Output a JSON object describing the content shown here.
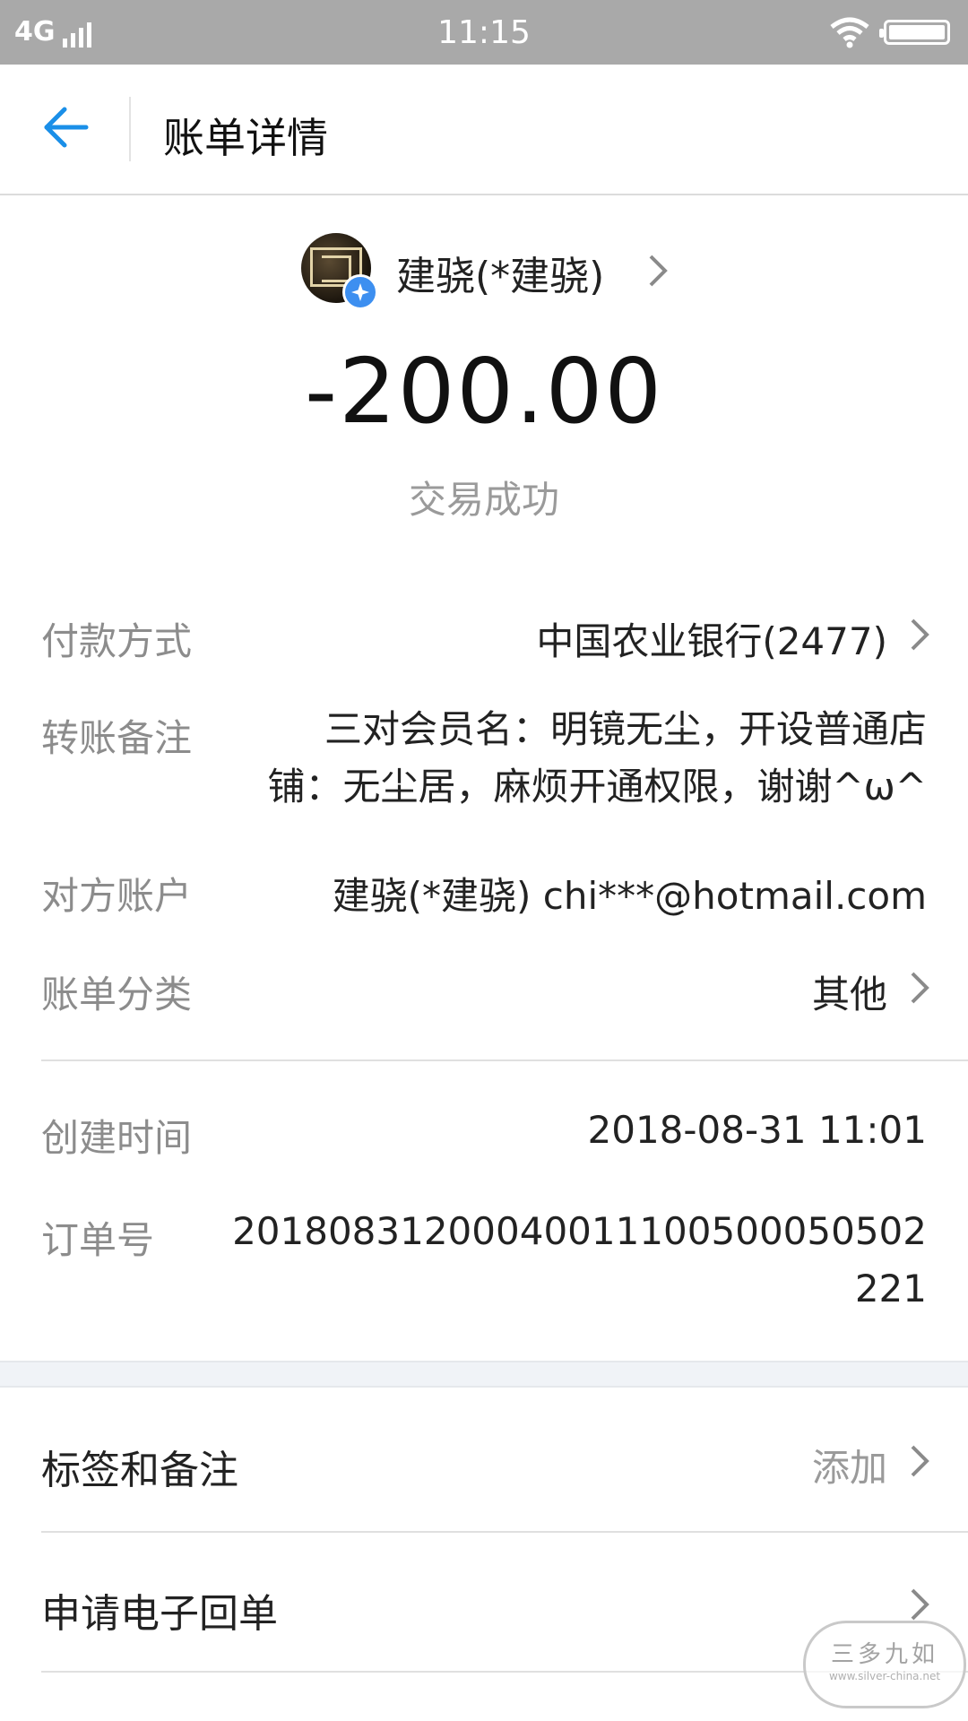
{
  "status_bar": {
    "network": "4G",
    "time": "11:15"
  },
  "nav": {
    "title": "账单详情"
  },
  "header": {
    "merchant_name": "建骁(*建骁)",
    "amount": "-200.00",
    "status": "交易成功"
  },
  "details": {
    "payment_method": {
      "label": "付款方式",
      "value": "中国农业银行(2477)"
    },
    "transfer_note": {
      "label": "转账备注",
      "line1": "三对会员名：明镜无尘，开设普通店",
      "line2": "铺：无尘居，麻烦开通权限，谢谢^ω^"
    },
    "counterparty": {
      "label": "对方账户",
      "value": "建骁(*建骁) chi***@hotmail.com"
    },
    "category": {
      "label": "账单分类",
      "value": "其他"
    },
    "created_time": {
      "label": "创建时间",
      "value": "2018-08-31 11:01"
    },
    "order_number": {
      "label": "订单号",
      "line1": "201808312000400111005000505​02",
      "line2": "221"
    }
  },
  "actions": {
    "tags_notes": {
      "label": "标签和备注",
      "value": "添加"
    },
    "e_receipt": {
      "label": "申请电子回单"
    }
  },
  "watermark": {
    "text": "三多九如",
    "url": "www.silver-china.net"
  },
  "colors": {
    "accent": "#1a8fe8",
    "status_bar": "#a9a9a9",
    "label_gray": "#8c8c8c"
  }
}
